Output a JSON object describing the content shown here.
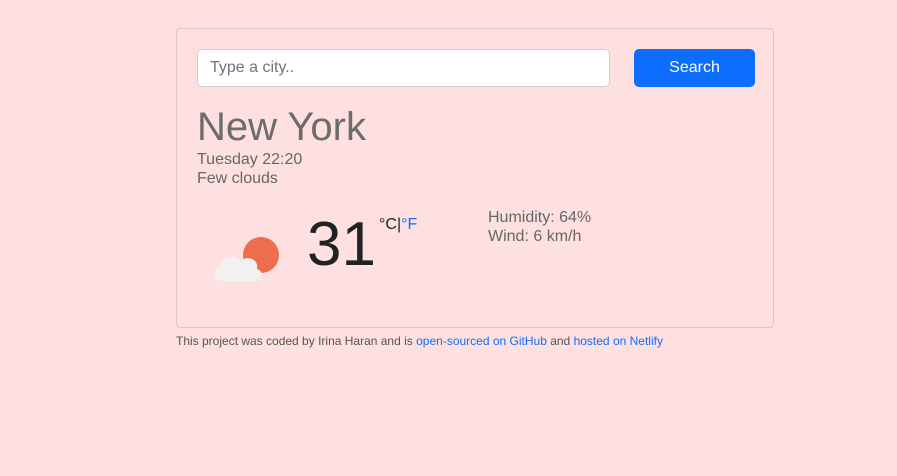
{
  "search": {
    "placeholder": "Type a city..",
    "value": "",
    "button_label": "Search"
  },
  "weather": {
    "city": "New York",
    "datetime": "Tuesday 22:20",
    "description": "Few clouds",
    "icon": "few-clouds-night-icon",
    "temperature": "31",
    "unit_celsius": "°C",
    "unit_separator": "|",
    "unit_fahrenheit": "°F",
    "humidity": "Humidity: 64%",
    "wind": "Wind: 6 km/h"
  },
  "footer": {
    "prefix": "This project was coded by Irina Haran and is ",
    "github_link": "open-sourced on GitHub",
    "middle": " and ",
    "netlify_link": "hosted on Netlify"
  },
  "colors": {
    "background": "#ffe0e0",
    "accent": "#0d6efd",
    "sun": "#ec6e4c",
    "cloud": "#f1f1f1"
  }
}
